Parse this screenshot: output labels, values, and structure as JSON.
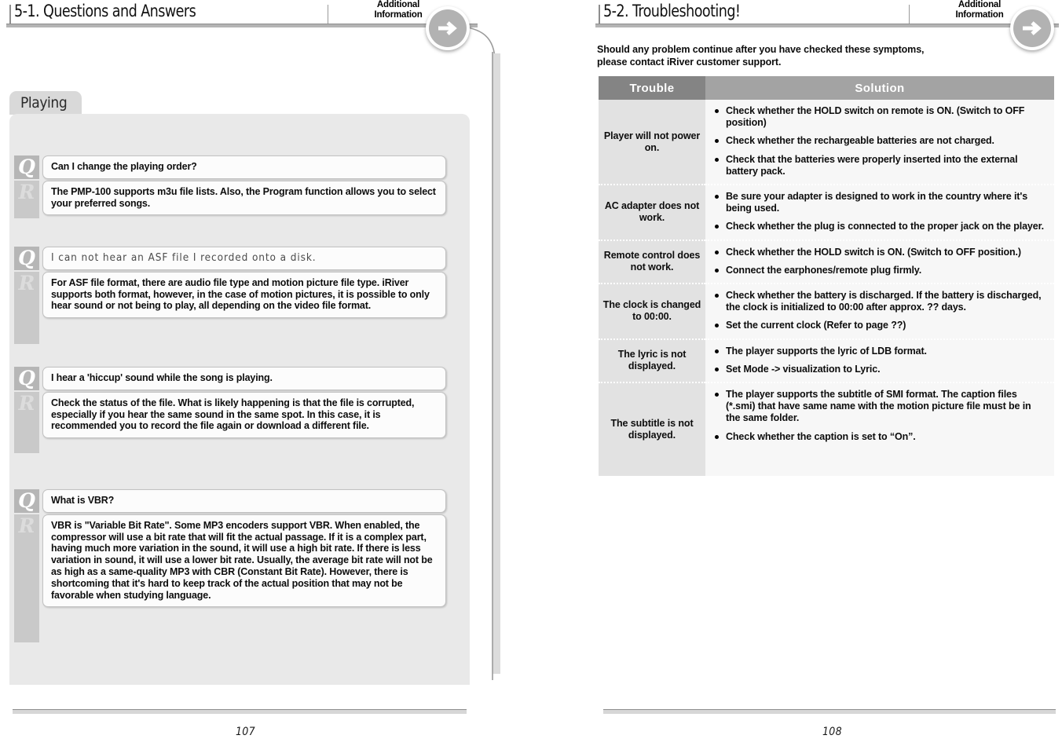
{
  "left_page": {
    "header": {
      "title": "5-1. Questions and Answers",
      "side_label_line1": "Additional",
      "side_label_line2": "Information",
      "arrow_icon": "arrow-right-circle-icon"
    },
    "tab_label": "Playing",
    "qa": [
      {
        "q_badge": "Q",
        "r_badge": "R",
        "question": "Can I change the playing order?",
        "question_style": "bold",
        "answer": "The PMP-100 supports m3u file lists. Also, the Program function allows you to select your preferred songs."
      },
      {
        "q_badge": "Q",
        "r_badge": "R",
        "question": "I can not hear an ASF file I recorded onto a disk.",
        "question_style": "thin",
        "answer": "For ASF file format, there are audio file type and motion picture file type. iRiver supports both format, however, in the case of motion pictures, it is possible to only hear sound or not being to play, all depending on the video file format."
      },
      {
        "q_badge": "Q",
        "r_badge": "R",
        "question": "I hear a 'hiccup' sound while the song is playing.",
        "question_style": "bold",
        "answer": "Check the status of the file. What is likely happening is that the file is corrupted, especially if you hear the same sound in the same spot. In this case, it is recommended you to record the file again or download a different file."
      },
      {
        "q_badge": "Q",
        "r_badge": "R",
        "question": "What is VBR?",
        "question_style": "bold",
        "answer": "VBR is \"Variable Bit Rate\". Some MP3 encoders support VBR. When enabled, the compressor will use a bit rate that will fit the actual passage. If it is a complex part, having much more variation in the sound, it will use a high bit rate. If there is less variation in sound, it will use a lower bit rate. Usually, the average bit rate will not be as high as a same-quality MP3 with CBR (Constant Bit Rate). However, there is shortcoming that it's hard to keep track of the actual position that may not be favorable when studying language."
      }
    ],
    "page_number": "107"
  },
  "right_page": {
    "header": {
      "title": "5-2. Troubleshooting!",
      "side_label_line1": "Additional",
      "side_label_line2": "Information",
      "arrow_icon": "arrow-right-circle-icon"
    },
    "intro_line1": "Should any problem continue after you have checked these symptoms,",
    "intro_line2": "please contact iRiver customer support.",
    "table": {
      "columns": [
        "Trouble",
        "Solution"
      ],
      "rows": [
        {
          "trouble": "Player will not power on.",
          "solutions": [
            "Check whether the HOLD switch on remote is ON. (Switch to OFF position)",
            "Check whether the rechargeable batteries are not charged.",
            "Check that the batteries were properly inserted into the external battery pack."
          ]
        },
        {
          "trouble": "AC adapter does not work.",
          "solutions": [
            "Be sure your adapter is designed to work in the country where it's being used.",
            "Check whether the plug is connected to the proper jack on the player."
          ]
        },
        {
          "trouble": "Remote control does not work.",
          "solutions": [
            "Check whether the HOLD switch is ON. (Switch to OFF position.)",
            "Connect the earphones/remote plug firmly."
          ]
        },
        {
          "trouble": "The clock is changed to 00:00.",
          "solutions": [
            "Check whether the battery is discharged. If the battery is discharged, the clock is initialized to 00:00 after approx. ?? days.",
            "Set the current clock (Refer to page ??)"
          ]
        },
        {
          "trouble": "The lyric is not displayed.",
          "solutions": [
            "The player supports the lyric of LDB format.",
            "Set Mode -> visualization to Lyric."
          ]
        },
        {
          "trouble": "The subtitle is not displayed.",
          "solutions": [
            "The player supports the subtitle of SMI format. The caption files (*.smi) that have same name with the motion picture file must be in the same folder.",
            "Check whether the caption is set to “On”."
          ]
        }
      ]
    },
    "page_number": "108"
  },
  "colors": {
    "header_rule": "#b4b4b4",
    "panel_bg": "#e9e9e9",
    "tab_bg": "#d9d9d9",
    "badge_q_bg": "#b6b6b6",
    "badge_r_bg": "#c9c9c9",
    "table_header_trouble": "#848484",
    "table_header_solution": "#a3a3a3",
    "table_cell_trouble": "#e2e2e2",
    "table_cell_solution": "#f7f7f7",
    "arrow_disc": "#b2b2b2"
  }
}
